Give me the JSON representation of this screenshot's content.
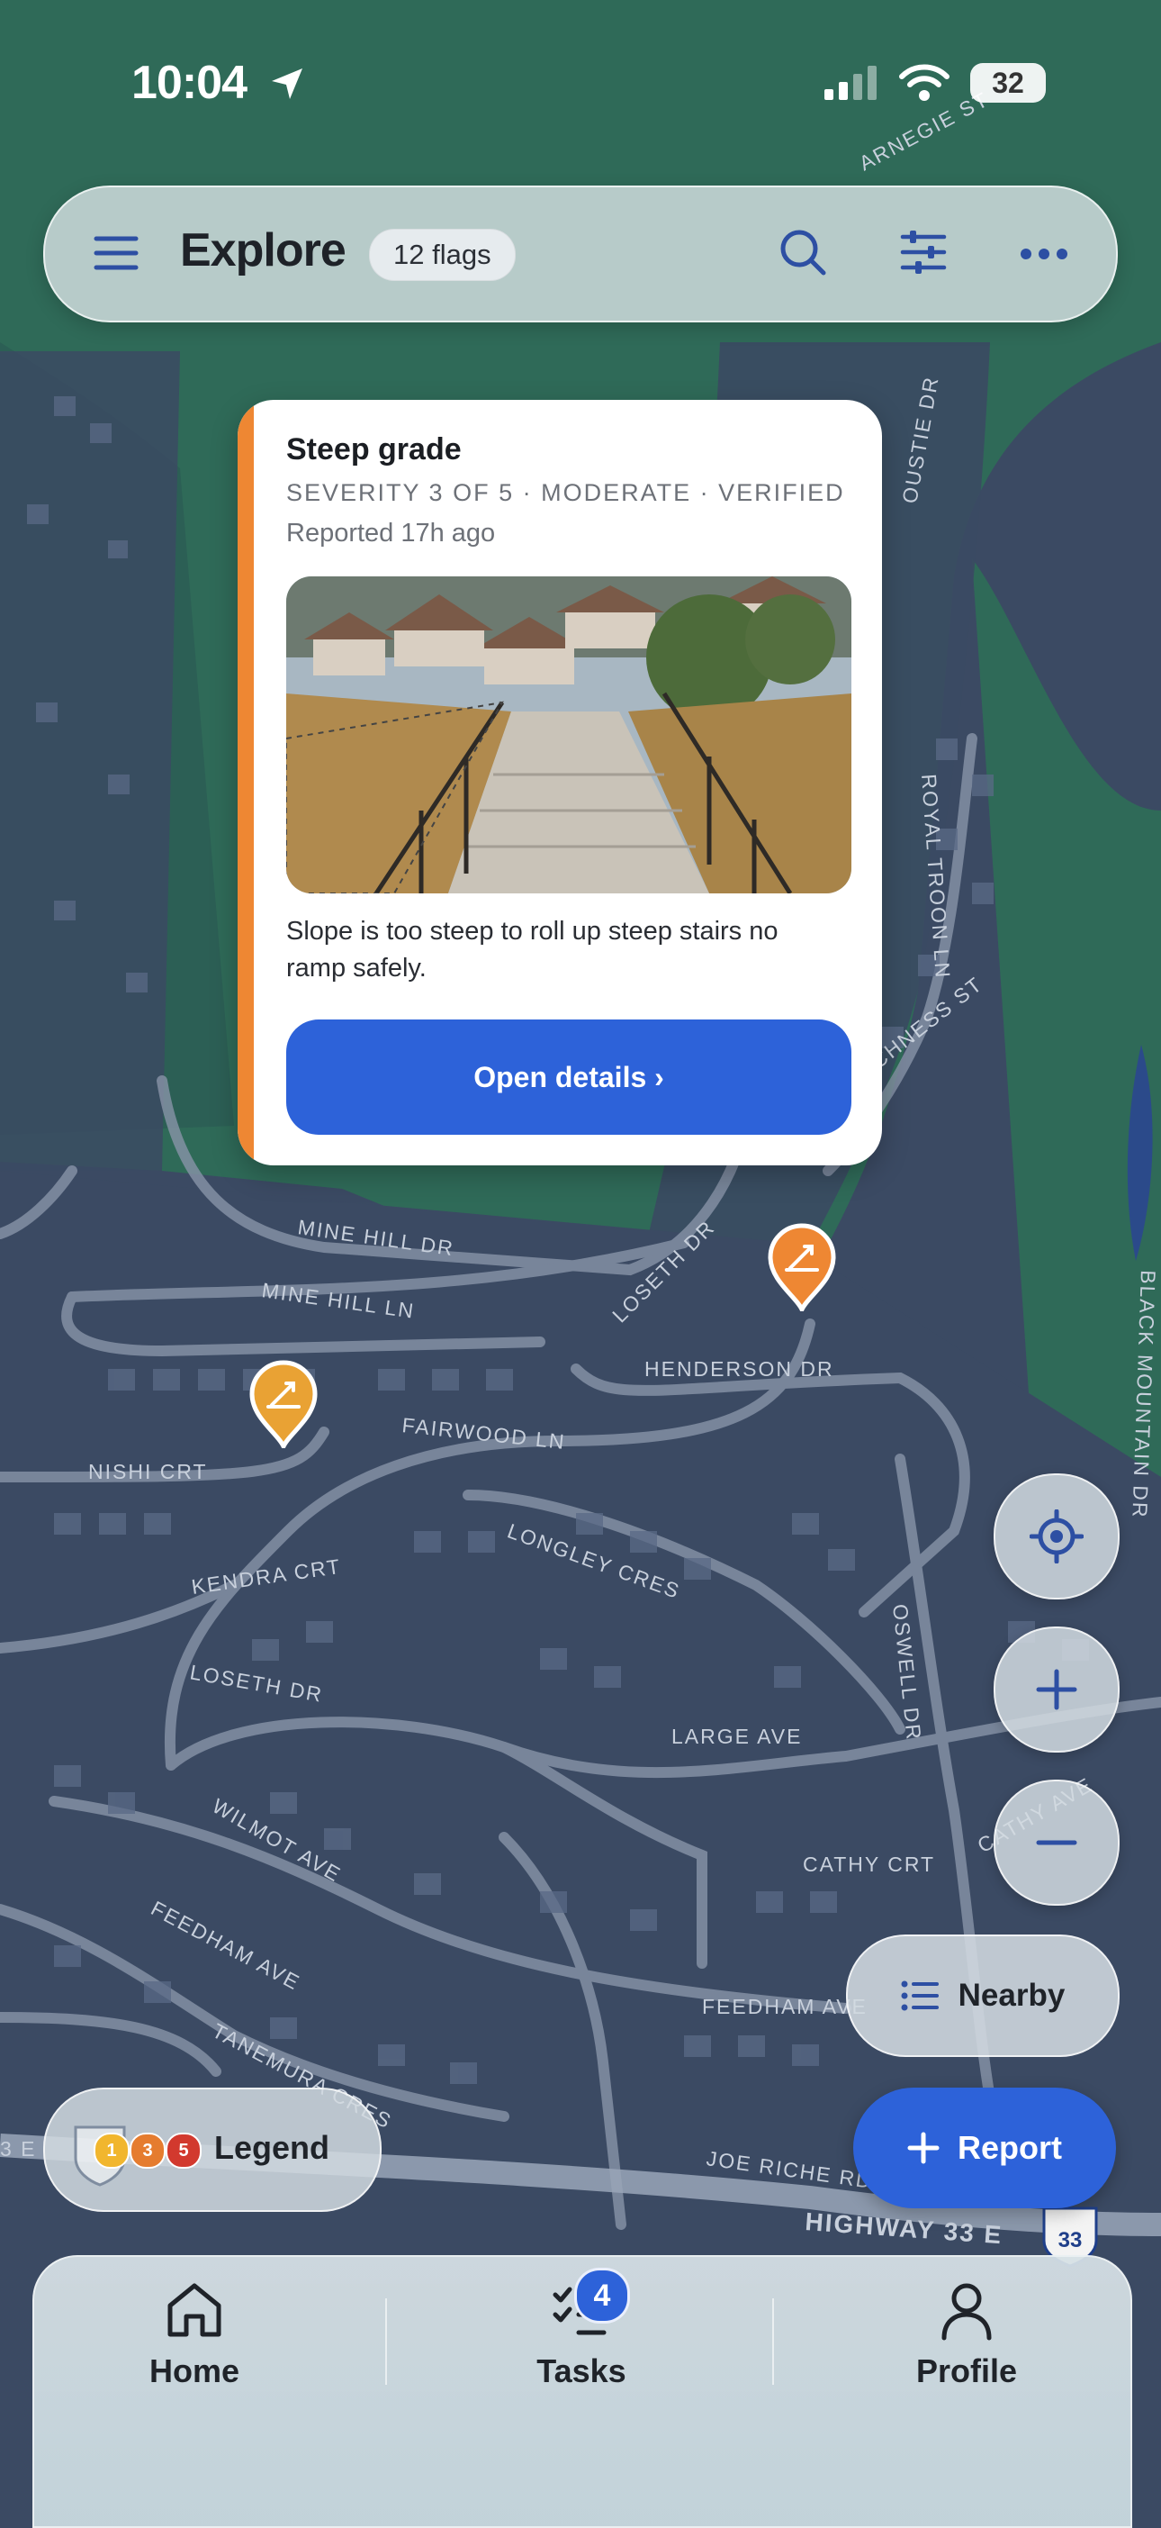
{
  "status_bar": {
    "time": "10:04",
    "battery": "32"
  },
  "header": {
    "title": "Explore",
    "flags_chip": "12 flags"
  },
  "card": {
    "title": "Steep grade",
    "meta": "SEVERITY 3 OF 5 · MODERATE · VERIFIED",
    "reported": "Reported 17h ago",
    "description": "Slope is too steep to roll up steep stairs no ramp safely.",
    "button": "Open details ›",
    "accent_color": "#ee8733"
  },
  "map": {
    "streets": [
      "ARNEGIE ST",
      "OUSTIE DR",
      "ROYAL TROON LN",
      "OCHNESS ST",
      "MINE HILL DR",
      "MINE HILL LN",
      "LOSETH DR",
      "HENDERSON DR",
      "FAIRWOOD LN",
      "NISHI CRT",
      "KENDRA CRT",
      "LONGLEY CRES",
      "LOSETH DR",
      "OSWELL DR",
      "LARGE AVE",
      "WILMOT AVE",
      "CATHY CRT",
      "CATHY AVE",
      "FEEDHAM AVE",
      "FEEDHAM AVE",
      "TANEMURA CRES",
      "JOE RICHE RD",
      "HIGHWAY 33 E",
      "BLACK MOUNTAIN DR",
      "3 E"
    ],
    "highway_shield": "33",
    "markers": [
      {
        "color": "#ee8733",
        "icon": "steep-grade-icon"
      },
      {
        "color": "#e9a234",
        "icon": "steep-grade-icon"
      }
    ]
  },
  "controls": {
    "nearby_label": "Nearby",
    "report_label": "Report",
    "legend_label": "Legend"
  },
  "legend": {
    "levels": [
      "1",
      "3",
      "5"
    ],
    "colors": [
      "#f1b62e",
      "#e57c2f",
      "#d2392e"
    ]
  },
  "nav": {
    "items": [
      {
        "label": "Home",
        "icon": "home-icon"
      },
      {
        "label": "Tasks",
        "icon": "tasks-icon"
      },
      {
        "label": "Profile",
        "icon": "profile-icon"
      }
    ],
    "tasks_badge": "4"
  },
  "colors": {
    "primary": "#2d62d9",
    "map_land": "#3b4a63",
    "map_park": "#2f6a58"
  }
}
